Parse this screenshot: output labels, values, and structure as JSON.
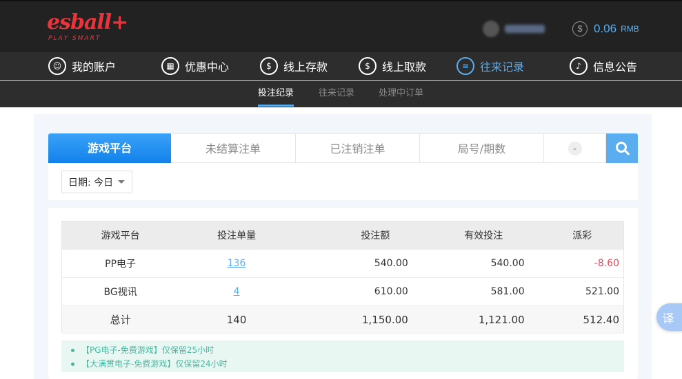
{
  "header": {
    "logo_text": "esball+",
    "logo_tagline": "PLAY SMART",
    "balance_amount": "0.06",
    "balance_unit": "RMB"
  },
  "main_nav": [
    {
      "label": "我的账户",
      "icon": "user-icon",
      "active": false
    },
    {
      "label": "优惠中心",
      "icon": "gift-icon",
      "active": false
    },
    {
      "label": "线上存款",
      "icon": "deposit-icon",
      "active": false
    },
    {
      "label": "线上取款",
      "icon": "withdraw-icon",
      "active": false
    },
    {
      "label": "往来记录",
      "icon": "records-icon",
      "active": true
    },
    {
      "label": "信息公告",
      "icon": "bell-icon",
      "active": false
    }
  ],
  "sub_nav": [
    {
      "label": "投注纪录",
      "active": true
    },
    {
      "label": "往来记录",
      "active": false
    },
    {
      "label": "处理中订单",
      "active": false
    }
  ],
  "filter_tabs": [
    {
      "label": "游戏平台",
      "active": true
    },
    {
      "label": "未结算注单",
      "active": false
    },
    {
      "label": "已注销注单",
      "active": false
    },
    {
      "label": "局号/期数",
      "active": false
    }
  ],
  "date_filter": {
    "label": "日期: 今日"
  },
  "table": {
    "headers": [
      "游戏平台",
      "投注单量",
      "投注额",
      "有效投注",
      "派彩"
    ],
    "rows": [
      {
        "platform": "PP电子",
        "count": "136",
        "bet": "540.00",
        "valid": "540.00",
        "payout": "-8.60"
      },
      {
        "platform": "BG视讯",
        "count": "4",
        "bet": "610.00",
        "valid": "581.00",
        "payout": "521.00"
      }
    ],
    "total": {
      "label": "总计",
      "count": "140",
      "bet": "1,150.00",
      "valid": "1,121.00",
      "payout": "512.40"
    }
  },
  "notes": [
    "【PG电子-免费游戏】仅保留25小时",
    "【大满贯电子-免费游戏】仅保留24小时"
  ],
  "translate_button": {
    "label": "译"
  },
  "colors": {
    "accent": "#5aaef0",
    "active_tab": "#1a8cf0",
    "negative": "#e0485a",
    "note_text": "#47b8a0"
  }
}
